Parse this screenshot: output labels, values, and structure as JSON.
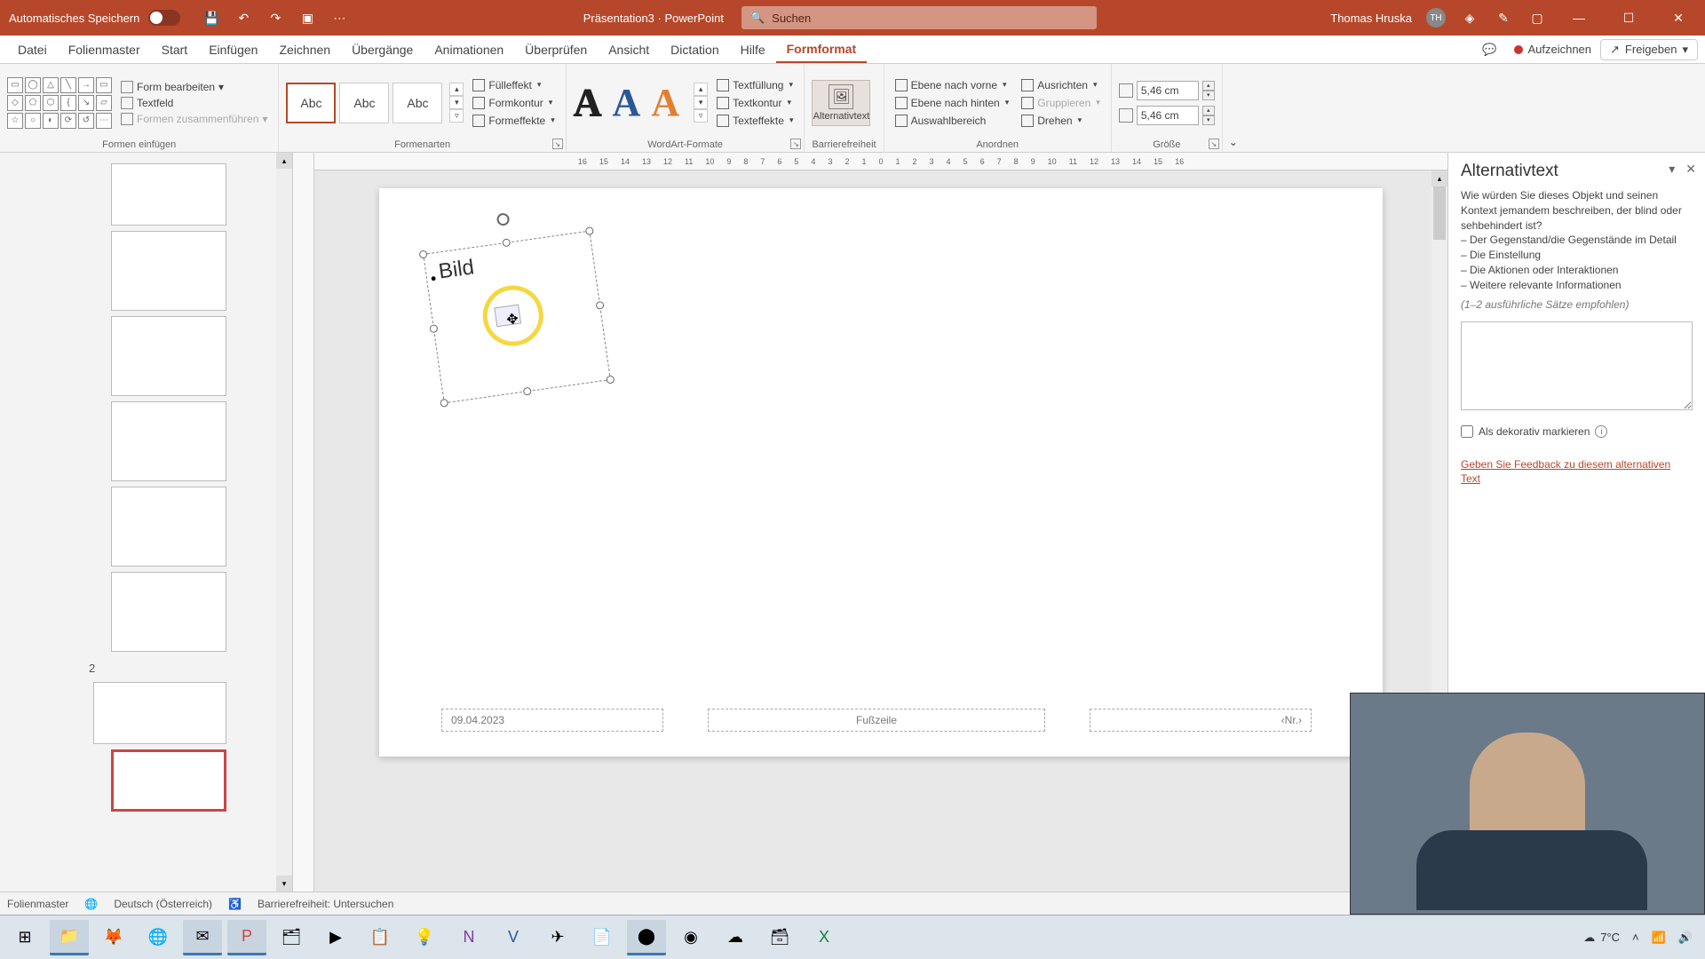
{
  "titlebar": {
    "autosave_label": "Automatisches Speichern",
    "doc_name": "Präsentation3",
    "app_name": "PowerPoint",
    "search_placeholder": "Suchen",
    "user_name": "Thomas Hruska",
    "user_initials": "TH"
  },
  "tabs": {
    "items": [
      "Datei",
      "Folienmaster",
      "Start",
      "Einfügen",
      "Zeichnen",
      "Übergänge",
      "Animationen",
      "Überprüfen",
      "Ansicht",
      "Dictation",
      "Hilfe",
      "Formformat"
    ],
    "active": "Formformat",
    "record": "Aufzeichnen",
    "share": "Freigeben"
  },
  "ribbon": {
    "g1": {
      "label": "Formen einfügen",
      "edit_shape": "Form bearbeiten",
      "textbox": "Textfeld",
      "merge": "Formen zusammenführen"
    },
    "g2": {
      "label": "Formenarten",
      "fill": "Fülleffekt",
      "outline": "Formkontur",
      "effects": "Formeffekte",
      "abc": "Abc"
    },
    "g3": {
      "label": "WordArt-Formate",
      "tfill": "Textfüllung",
      "toutline": "Textkontur",
      "teffects": "Texteffekte"
    },
    "g4": {
      "label": "Barrierefreiheit",
      "alt": "Alternativtext"
    },
    "g5": {
      "label": "Anordnen",
      "front": "Ebene nach vorne",
      "back": "Ebene nach hinten",
      "selpane": "Auswahlbereich",
      "align": "Ausrichten",
      "group": "Gruppieren",
      "rotate": "Drehen"
    },
    "g6": {
      "label": "Größe",
      "h": "5,46 cm",
      "w": "5,46 cm"
    }
  },
  "ruler_ticks": [
    "16",
    "15",
    "14",
    "13",
    "12",
    "11",
    "10",
    "9",
    "8",
    "7",
    "6",
    "5",
    "4",
    "3",
    "2",
    "1",
    "0",
    "1",
    "2",
    "3",
    "4",
    "5",
    "6",
    "7",
    "8",
    "9",
    "10",
    "11",
    "12",
    "13",
    "14",
    "15",
    "16"
  ],
  "slide": {
    "placeholder_label": "Bild",
    "date": "09.04.2023",
    "footer": "Fußzeile",
    "page": "‹Nr.›"
  },
  "thumbnails": {
    "section2": "2"
  },
  "alt_pane": {
    "title": "Alternativtext",
    "intro": "Wie würden Sie dieses Objekt und seinen Kontext jemandem beschreiben, der blind oder sehbehindert ist?",
    "b1": "Der Gegenstand/die Gegenstände im Detail",
    "b2": "Die Einstellung",
    "b3": "Die Aktionen oder Interaktionen",
    "b4": "Weitere relevante Informationen",
    "note": "(1–2 ausführliche Sätze empfohlen)",
    "decorative": "Als dekorativ markieren",
    "feedback": "Geben Sie Feedback zu diesem alternativen Text"
  },
  "status": {
    "view": "Folienmaster",
    "lang": "Deutsch (Österreich)",
    "a11y": "Barrierefreiheit: Untersuchen"
  },
  "taskbar": {
    "weather_temp": "7°C"
  }
}
